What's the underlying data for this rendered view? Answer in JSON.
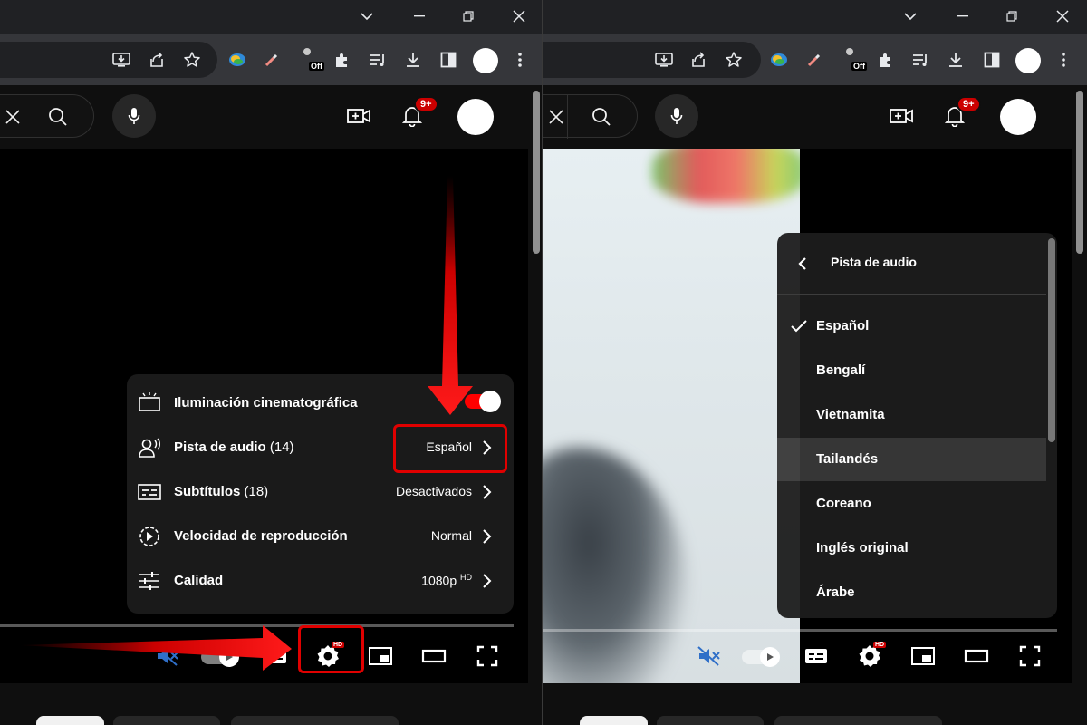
{
  "left": {
    "browser": {
      "extension_badge": "Off"
    },
    "youtube": {
      "notification_count": "9+"
    },
    "settings_menu": {
      "rows": [
        {
          "label": "Iluminación cinematográfica",
          "count": "",
          "value": ""
        },
        {
          "label": "Pista de audio",
          "count": "(14)",
          "value": "Español"
        },
        {
          "label": "Subtítulos",
          "count": "(18)",
          "value": "Desactivados"
        },
        {
          "label": "Velocidad de reproducción",
          "count": "",
          "value": "Normal"
        },
        {
          "label": "Calidad",
          "count": "",
          "value": "1080p",
          "value_sup": "HD"
        }
      ],
      "ambient_mode_on": true
    },
    "player": {
      "settings_badge": "HD"
    }
  },
  "right": {
    "browser": {
      "extension_badge": "Off"
    },
    "youtube": {
      "notification_count": "9+"
    },
    "audio_menu": {
      "title": "Pista de audio",
      "items": [
        {
          "label": "Español",
          "selected": true
        },
        {
          "label": "Bengalí",
          "selected": false
        },
        {
          "label": "Vietnamita",
          "selected": false
        },
        {
          "label": "Tailandés",
          "selected": false,
          "hovered": true
        },
        {
          "label": "Coreano",
          "selected": false
        },
        {
          "label": "Inglés original",
          "selected": false
        },
        {
          "label": "Árabe",
          "selected": false
        }
      ]
    },
    "player": {
      "settings_badge": "HD"
    }
  },
  "colors": {
    "accent_red": "#ff0000",
    "annotation_red": "#e00000",
    "menu_bg": "#1c1c1c",
    "page_bg": "#0f0f0f"
  }
}
